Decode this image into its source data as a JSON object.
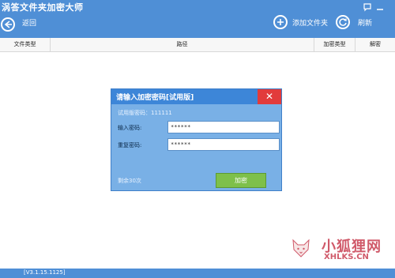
{
  "window": {
    "title": "涡答文件夹加密大师"
  },
  "toolbar": {
    "back_label": "返回",
    "add_folder_label": "添加文件夹",
    "refresh_label": "刷新"
  },
  "table": {
    "columns": [
      "文件类型",
      "路径",
      "加密类型",
      "解密"
    ]
  },
  "dialog": {
    "title": "请输入加密密码[试用版]",
    "trial_password_text": "试用版密码：111111",
    "password_label": "输入密码:",
    "password_value": "******",
    "confirm_label": "重复密码:",
    "confirm_value": "******",
    "remaining_text": "剩余30次",
    "encrypt_button": "加密",
    "close_glyph": "✕"
  },
  "status": {
    "version": "[V3.1.15.1125]"
  },
  "watermark": {
    "brand": "小狐狸网",
    "url": "XHLKS.CN"
  },
  "colors": {
    "titlebar": "#4f8fd6",
    "dialog_body": "#79b0e6",
    "dialog_header": "#3d86d8",
    "close": "#e23b3b",
    "encrypt_button": "#7ec04a"
  }
}
